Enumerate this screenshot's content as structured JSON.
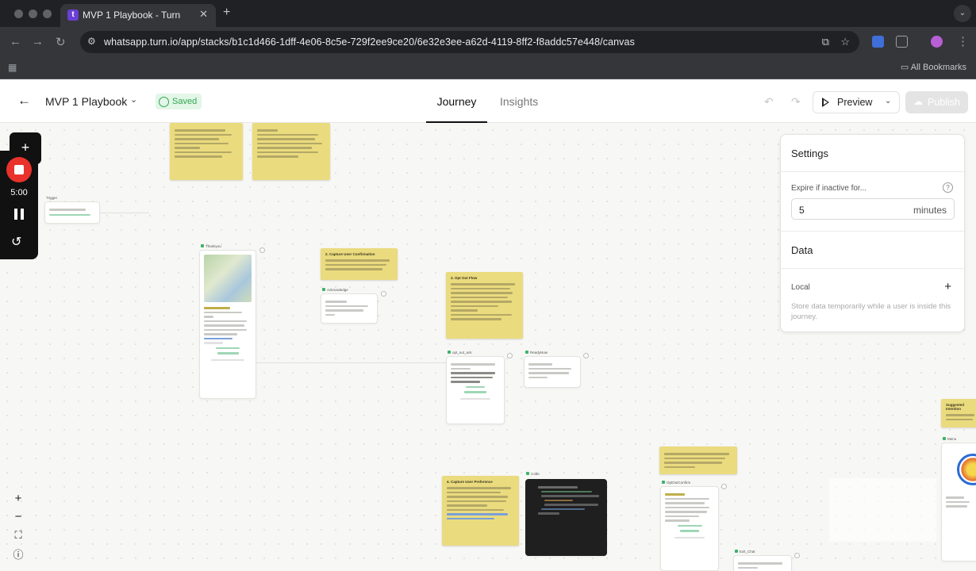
{
  "browser": {
    "tab_title": "MVP 1 Playbook - Turn",
    "tab_favicon": "t",
    "url": "whatsapp.turn.io/app/stacks/b1c1d466-1dff-4e06-8c5e-729f2ee9ce20/6e32e3ee-a62d-4119-8ff2-f8addc57e448/canvas",
    "all_bookmarks": "All Bookmarks"
  },
  "header": {
    "title": "MVP 1 Playbook",
    "saved_label": "Saved",
    "tabs": [
      {
        "label": "Journey",
        "active": true
      },
      {
        "label": "Insights",
        "active": false
      }
    ],
    "preview_label": "Preview",
    "publish_label": "Publish"
  },
  "recorder": {
    "time": "5:00"
  },
  "settings": {
    "title": "Settings",
    "expire_label": "Expire if inactive for...",
    "expire_value": "5",
    "expire_unit": "minutes",
    "data_title": "Data",
    "local_label": "Local",
    "local_description": "Store data temporarily while a user is inside this journey."
  },
  "canvas": {
    "notes": [
      {
        "title": "2. Capture User Confirmation"
      },
      {
        "title": "3. Opt Out Flow"
      },
      {
        "title": "4. Capture User Preference"
      },
      {
        "title": "Suggested Intention"
      }
    ],
    "cards": [
      {
        "title": "Trigger"
      },
      {
        "title": "Thankyou"
      },
      {
        "title": "Acknowledge"
      },
      {
        "title": "opt_out_ack"
      },
      {
        "title": "ReadyNow"
      },
      {
        "title": "OptOutConfirm"
      },
      {
        "title": "Code"
      },
      {
        "title": "Exit_Chat"
      },
      {
        "title": "Menu"
      }
    ]
  },
  "colors": {
    "sticky": "#eadb7e",
    "saved_green": "#30a84f",
    "record_red": "#e9322c"
  }
}
